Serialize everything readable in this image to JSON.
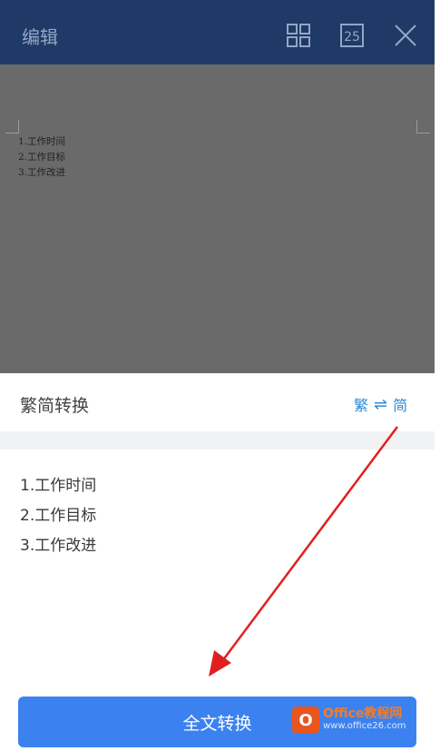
{
  "header": {
    "title": "编辑",
    "page_count": "25",
    "icons": [
      "grid-icon",
      "page-count-icon",
      "close-icon"
    ]
  },
  "document": {
    "lines": [
      "1.工作时间",
      "2.工作目标",
      "3.工作改进"
    ]
  },
  "sheet": {
    "title": "繁简转换",
    "traditional": "繁",
    "simplified": "简",
    "items": [
      "1.工作时间",
      "2.工作目标",
      "3.工作改进"
    ],
    "convert_button": "全文转换"
  },
  "watermark": {
    "brand": "Office教程网",
    "url": "www.office26.com"
  },
  "colors": {
    "header_bg": "#1f3a66",
    "accent_blue": "#3b82f0",
    "swap_blue": "#2e8ad6",
    "annotation_red": "#e02020"
  }
}
